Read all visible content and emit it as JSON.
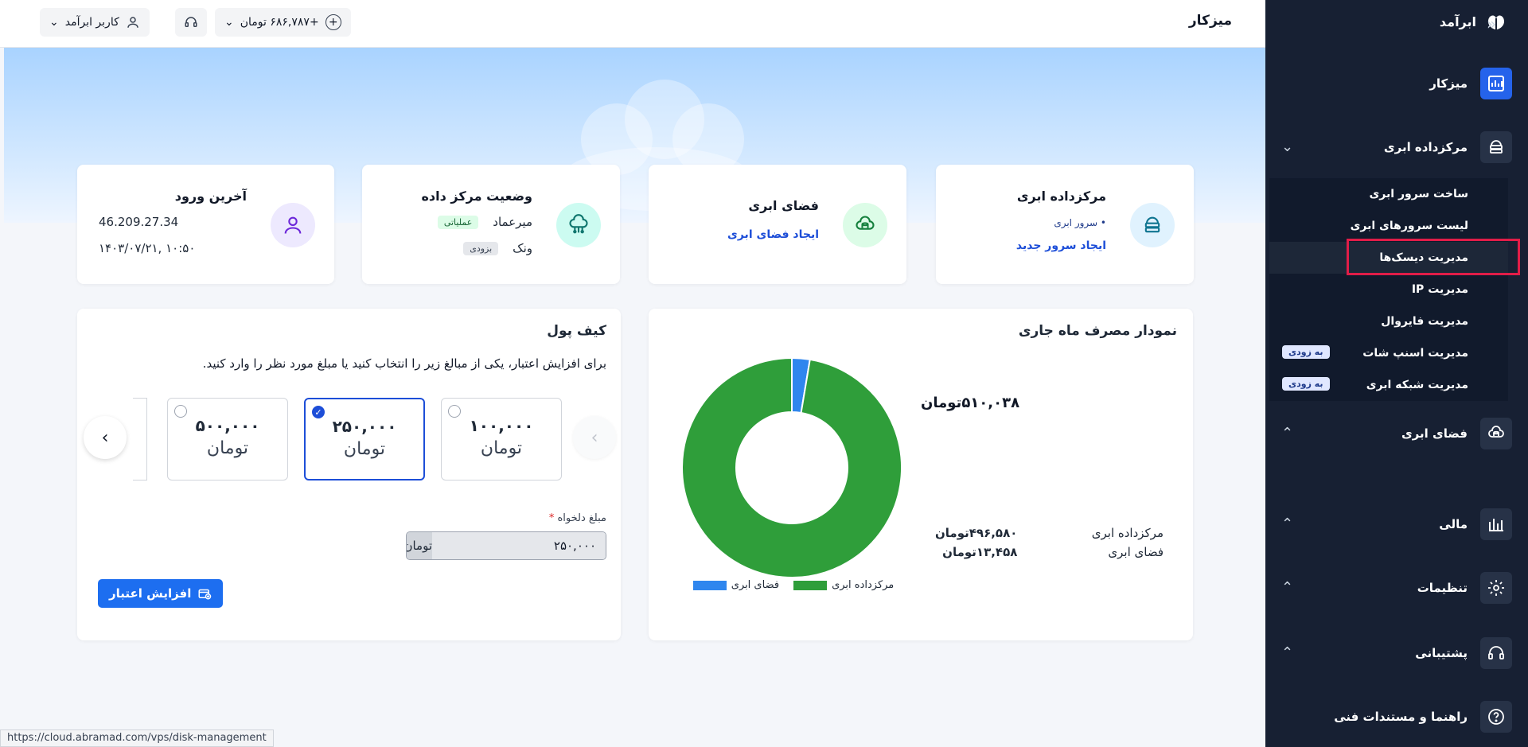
{
  "sidebar": {
    "brand": "ابرآمد",
    "items": {
      "dashboard": "میزکار",
      "cloud_dc": "مرکزداده ابری",
      "cloud_space": "فضای ابری",
      "finance": "مالی",
      "settings": "تنظیمات",
      "support": "پشتیبانی",
      "docs": "راهنما و مستندات فنی"
    },
    "sub_items": [
      "ساخت سرور ابری",
      "لیست سرورهای ابری",
      "مدیریت دیسک‌ها",
      "مدیریت IP",
      "مدیریت فایروال",
      "مدیریت اسنپ شات",
      "مدیریت شبکه ابری"
    ],
    "soon_label": "به زودی"
  },
  "topbar": {
    "title": "میزکار",
    "user": "کاربر ابرآمد",
    "balance": "+۶۸۶,۷۸۷ تومان"
  },
  "cards": {
    "dc": {
      "title": "مرکزداده ابری",
      "bullet": "سرور ابری",
      "link": "ایجاد سرور جدید"
    },
    "space": {
      "title": "فضای ابری",
      "link": "ایجاد فضای ابری"
    },
    "status": {
      "title": "وضعیت مرکز داده",
      "dc1": "میرعماد",
      "dc1_tag": "عملیاتی",
      "dc2": "ونک",
      "dc2_tag": "بزودی"
    },
    "login": {
      "title": "آخرین ورود",
      "ip": "46.209.27.34",
      "date": "۱۴۰۳/۰۷/۲۱, ۱۰:۵۰"
    }
  },
  "chart": {
    "title": "نمودار مصرف ماه جاری",
    "total": "۵۱۰,۰۳۸تومان",
    "rows": [
      {
        "label": "مرکزداده ابری",
        "value": "۴۹۶,۵۸۰تومان"
      },
      {
        "label": "فضای ابری",
        "value": "۱۳,۴۵۸تومان"
      }
    ],
    "legend": [
      "مرکزداده ابری",
      "فضای ابری"
    ]
  },
  "chart_data": {
    "type": "pie",
    "categories": [
      "مرکزداده ابری",
      "فضای ابری"
    ],
    "values": [
      496580,
      13458
    ],
    "colors": [
      "#2f9e3a",
      "#2f86ee"
    ],
    "title": "نمودار مصرف ماه جاری"
  },
  "wallet": {
    "title": "کیف پول",
    "desc": "برای افزایش اعتبار، یکی از مبالغ زیر را انتخاب کنید یا مبلغ مورد نظر را وارد کنید.",
    "amounts": [
      "۱۰۰,۰۰۰",
      "۲۵۰,۰۰۰",
      "۵۰۰,۰۰۰"
    ],
    "currency": "تومان",
    "custom_label": "مبلغ دلخواه",
    "custom_value": "۲۵۰,۰۰۰",
    "button": "افزایش اعتبار"
  },
  "status_url": "https://cloud.abramad.com/vps/disk-management"
}
